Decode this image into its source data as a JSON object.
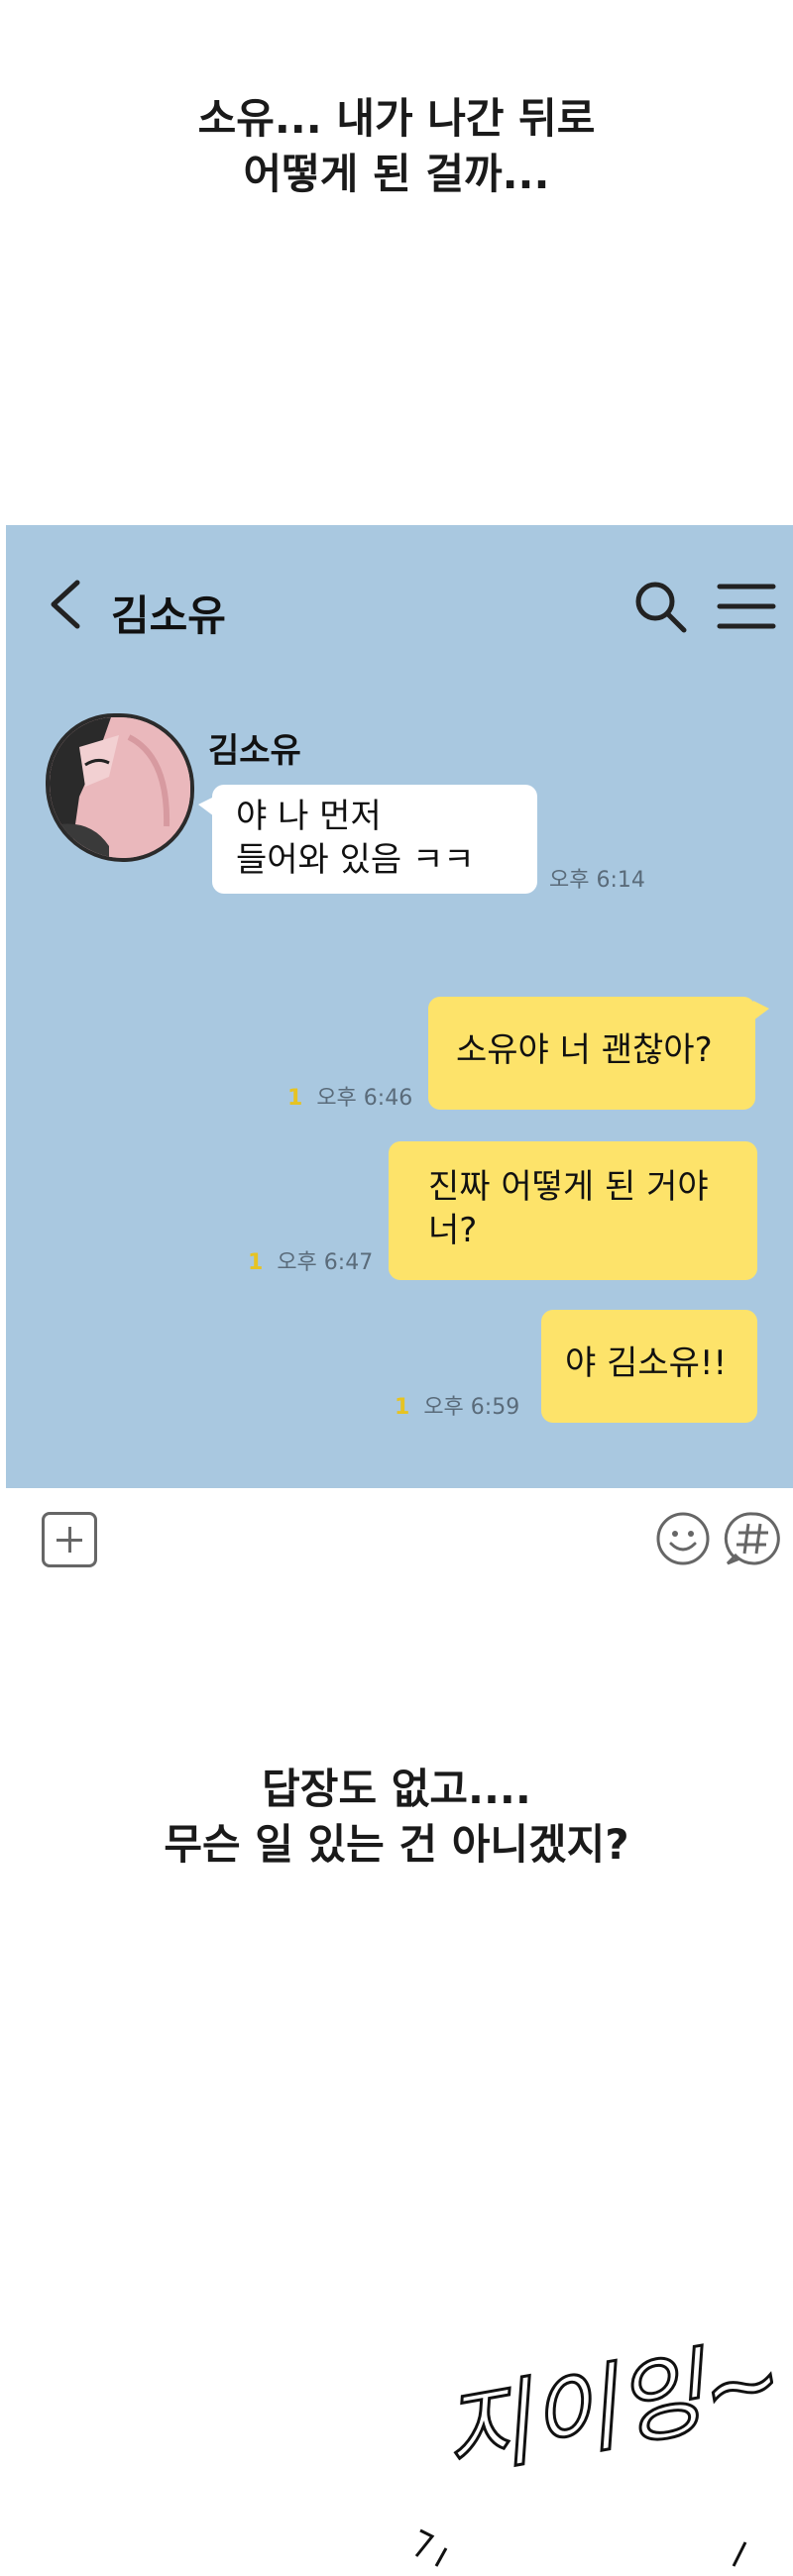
{
  "caption_top": {
    "lines": [
      "소유... 내가 나간 뒤로",
      "어떻게 된 걸까..."
    ]
  },
  "chat": {
    "header": {
      "title": "김소유",
      "back_icon": "chevron-left-icon",
      "search_icon": "search-icon",
      "menu_icon": "menu-icon"
    },
    "sender": "김소유",
    "messages": [
      {
        "direction": "incoming",
        "lines": [
          "야 나 먼저",
          "들어와 있음 ㅋㅋ"
        ],
        "time": "오후 6:14",
        "unread": ""
      },
      {
        "direction": "outgoing",
        "lines": [
          "소유야 너 괜찮아?"
        ],
        "time": "오후 6:46",
        "unread": "1"
      },
      {
        "direction": "outgoing",
        "lines": [
          "진짜 어떻게 된 거야",
          "너?"
        ],
        "time": "오후 6:47",
        "unread": "1"
      },
      {
        "direction": "outgoing",
        "lines": [
          "야 김소유!!"
        ],
        "time": "오후 6:59",
        "unread": "1"
      }
    ],
    "colors": {
      "background": "#a9c8e0",
      "incoming": "#ffffff",
      "outgoing": "#fde36a",
      "unread": "#e6c323"
    }
  },
  "bottom_bar": {
    "plus_icon": "plus-square-icon",
    "emoji_icon": "emoji-icon",
    "hashtag_icon": "hashtag-icon"
  },
  "caption_bottom": {
    "lines": [
      "답장도 없고....",
      "무슨 일 있는 건 아니겠지?"
    ]
  },
  "sfx_text": "지이잉~"
}
